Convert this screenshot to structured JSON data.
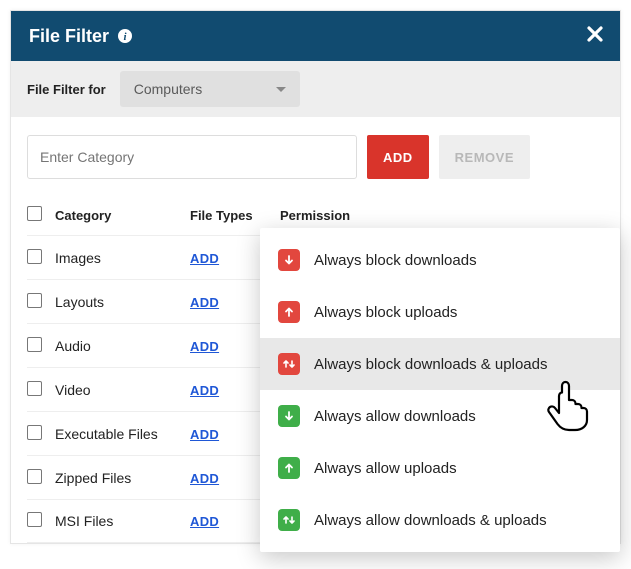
{
  "header": {
    "title": "File Filter"
  },
  "filterbar": {
    "label": "File Filter for",
    "select_value": "Computers"
  },
  "actionbar": {
    "input_placeholder": "Enter Category",
    "add_label": "ADD",
    "remove_label": "REMOVE"
  },
  "columns": {
    "category": "Category",
    "file_types": "File Types",
    "permission": "Permission"
  },
  "rows": [
    {
      "category": "Images",
      "add": "ADD"
    },
    {
      "category": "Layouts",
      "add": "ADD"
    },
    {
      "category": "Audio",
      "add": "ADD"
    },
    {
      "category": "Video",
      "add": "ADD"
    },
    {
      "category": "Executable Files",
      "add": "ADD"
    },
    {
      "category": "Zipped Files",
      "add": "ADD"
    },
    {
      "category": "MSI Files",
      "add": "ADD"
    }
  ],
  "menu": {
    "items": [
      {
        "label": "Always block downloads",
        "color": "red",
        "icon": "down"
      },
      {
        "label": "Always block uploads",
        "color": "red",
        "icon": "up"
      },
      {
        "label": "Always block downloads & uploads",
        "color": "red",
        "icon": "both",
        "selected": true
      },
      {
        "label": "Always allow downloads",
        "color": "green",
        "icon": "down"
      },
      {
        "label": "Always allow uploads",
        "color": "green",
        "icon": "up"
      },
      {
        "label": "Always allow downloads & uploads",
        "color": "green",
        "icon": "both"
      }
    ]
  }
}
